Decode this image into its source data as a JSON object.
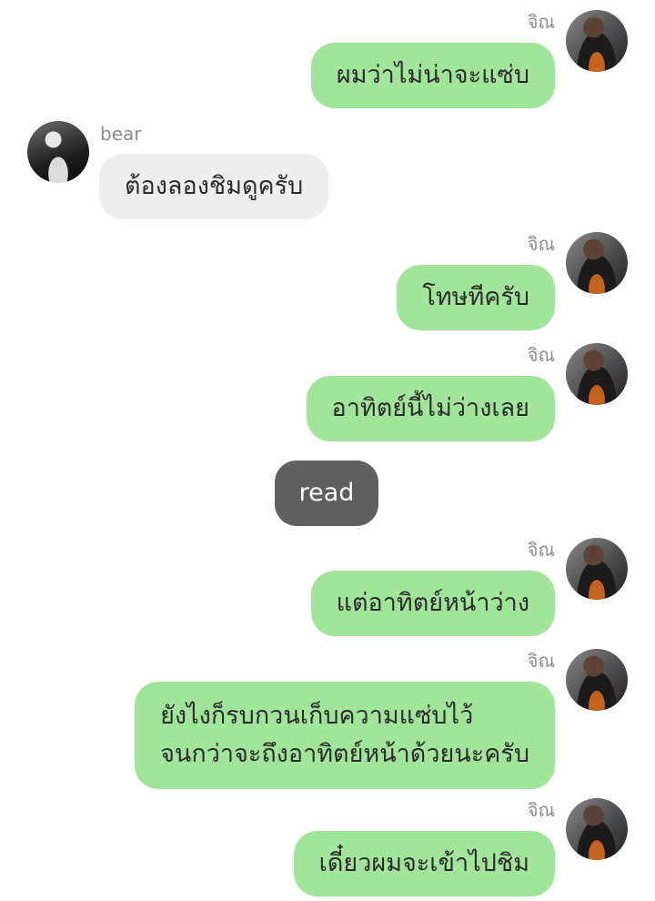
{
  "participants": {
    "me": {
      "name": "จิณ"
    },
    "other": {
      "name": "bear"
    }
  },
  "messages": [
    {
      "sender": "จิณ",
      "lines": [
        "ผมว่าไม่น่าจะแซ่บ"
      ]
    },
    {
      "sender": "bear",
      "lines": [
        "ต้องลองชิมดูครับ"
      ]
    },
    {
      "sender": "จิณ",
      "lines": [
        "โทษทีครับ"
      ]
    },
    {
      "sender": "จิณ",
      "lines": [
        "อาทิตย์นี้ไม่ว่างเลย"
      ]
    },
    {
      "sender": "จิณ",
      "lines": [
        "แต่อาทิตย์หน้าว่าง"
      ]
    },
    {
      "sender": "จิณ",
      "lines": [
        "ยังไงก็รบกวนเก็บความแซ่บไว้",
        "จนกว่าจะถึงอาทิตย์หน้าด้วยนะครับ"
      ]
    },
    {
      "sender": "จิณ",
      "lines": [
        "เดี๋ยวผมจะเข้าไปชิม"
      ]
    }
  ],
  "read_marker": {
    "label": "read"
  },
  "colors": {
    "my_bubble": "#a1e59b",
    "other_bubble": "#eeeeee",
    "read_pill": "#5f5f5f",
    "sender_name": "#8d8d8d"
  }
}
